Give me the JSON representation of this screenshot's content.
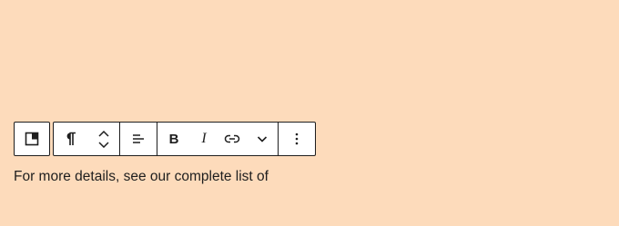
{
  "colors": {
    "background": "#fddbbb",
    "toolbar_bg": "#ffffff",
    "toolbar_border": "#1e1e1e",
    "text": "#1e1e1e"
  },
  "toolbar": {
    "block_type_icon": "reusable-block-icon",
    "groups": [
      {
        "name": "block-switcher",
        "items": [
          "reusable-block-icon"
        ]
      },
      {
        "name": "block-controls",
        "items": [
          "paragraph-icon",
          "move-up-down-icon"
        ]
      },
      {
        "name": "alignment",
        "items": [
          "align-left-icon"
        ]
      },
      {
        "name": "formatting",
        "items": [
          "bold",
          "italic",
          "link-icon",
          "chevron-down-icon"
        ]
      },
      {
        "name": "options",
        "items": [
          "more-vertical-icon"
        ]
      }
    ],
    "bold_label": "B",
    "italic_label": "I"
  },
  "editor": {
    "paragraph": "For more details, see our complete list of"
  }
}
